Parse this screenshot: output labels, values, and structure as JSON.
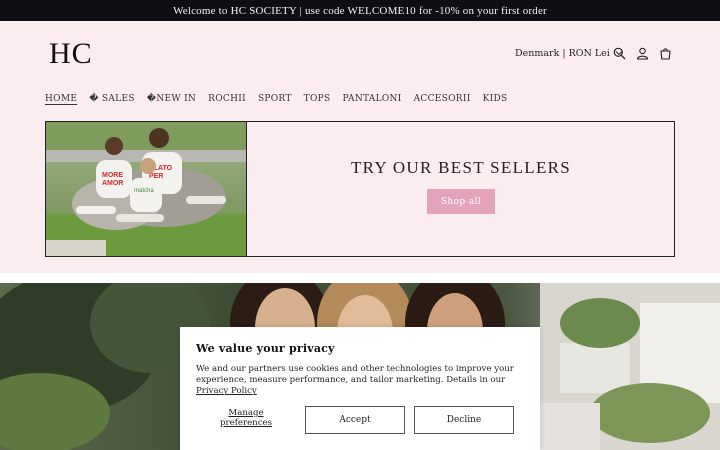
{
  "announcement": {
    "text": "Welcome to HC SOCIETY | use code WELCOME10 for -10% on your first order"
  },
  "header": {
    "logo": "HC",
    "locale": "Denmark | RON Lei",
    "icons": [
      "search-icon",
      "account-icon",
      "cart-icon"
    ]
  },
  "nav": {
    "items": [
      {
        "label": "HOME",
        "active": true
      },
      {
        "label": "� SALES"
      },
      {
        "label": "�NEW IN"
      },
      {
        "label": "ROCHII"
      },
      {
        "label": "SPORT"
      },
      {
        "label": "TOPS"
      },
      {
        "label": "PANTALONI"
      },
      {
        "label": "ACCESORII"
      },
      {
        "label": "KIDS"
      }
    ]
  },
  "banner": {
    "title": "TRY OUR BEST SELLERS",
    "button": "Shop all",
    "button_color": "#e3a3bb"
  },
  "cookie": {
    "title": "We value your privacy",
    "body": "We and our partners use cookies and other technologies to improve your experience, measure performance, and tailor marketing. Details in our ",
    "link": "Privacy Policy",
    "manage_line1": "Manage",
    "manage_line2": "preferences",
    "accept": "Accept",
    "decline": "Decline"
  },
  "colors": {
    "announcement_bg": "#0e0f14",
    "page_bg": "#fbecef",
    "accent": "#e3a3bb"
  }
}
